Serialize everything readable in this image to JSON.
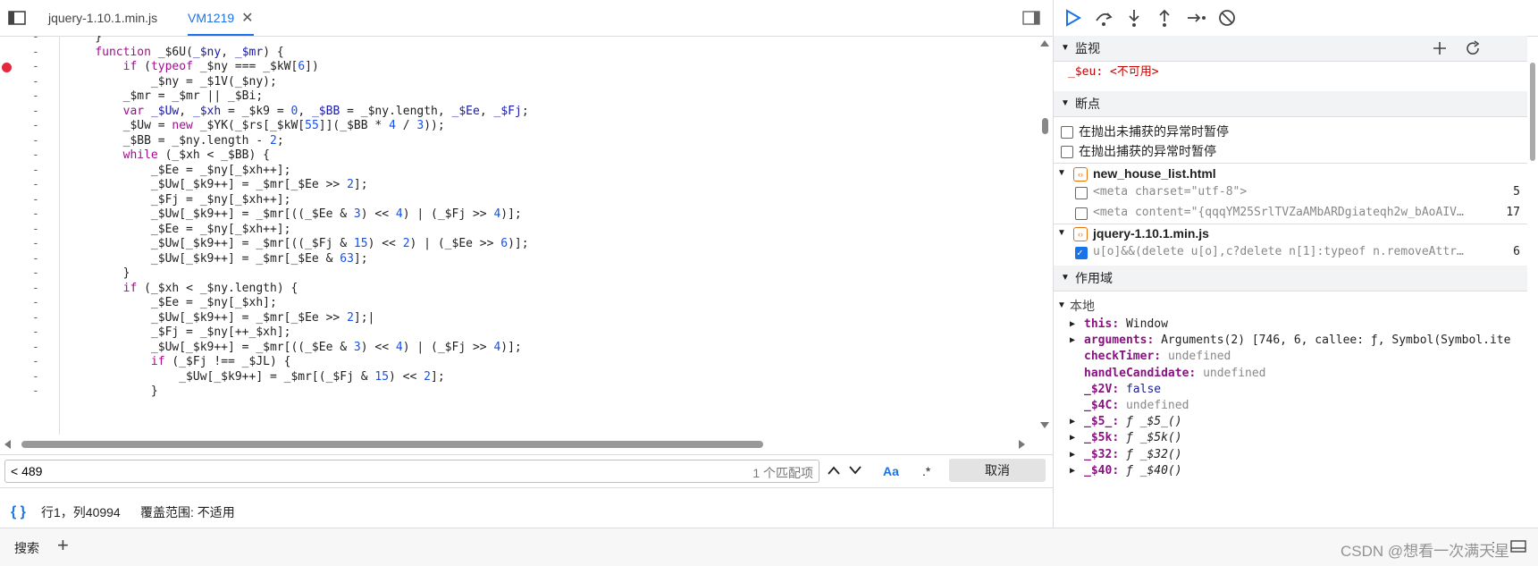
{
  "tabs": [
    {
      "label": "jquery-1.10.1.min.js"
    },
    {
      "label": "VM1219",
      "close": "✕"
    }
  ],
  "code_lines": [
    {
      "html": "    }"
    },
    {
      "html": "    <span class=\"kw\">function</span> _$6U(<span class=\"vr\">_$ny</span>, <span class=\"vr\">_$mr</span>) {"
    },
    {
      "html": "        <span class=\"kw\">if</span> (<span class=\"kw\">typeof</span> _$ny === _$kW[<span class=\"num\">6</span>])",
      "bp": true
    },
    {
      "html": "            _$ny = _$1V(_$ny);"
    },
    {
      "html": "        _$mr = _$mr || _$Bi;"
    },
    {
      "html": "        <span class=\"kw\">var</span> <span class=\"vr\">_$Uw</span>, <span class=\"vr\">_$xh</span> = _$k9 = <span class=\"num\">0</span>, <span class=\"vr\">_$BB</span> = _$ny.length, <span class=\"vr\">_$Ee</span>, <span class=\"vr\">_$Fj</span>;"
    },
    {
      "html": "        _$Uw = <span class=\"kw\">new</span> _$YK(_$rs[_$kW[<span class=\"num\">55</span>]](_$BB * <span class=\"num\">4</span> / <span class=\"num\">3</span>));"
    },
    {
      "html": "        _$BB = _$ny.length - <span class=\"num\">2</span>;"
    },
    {
      "html": "        <span class=\"kw\">while</span> (_$xh < _$BB) {"
    },
    {
      "html": "            _$Ee = _$ny[_$xh++];"
    },
    {
      "html": "            _$Uw[_$k9++] = _$mr[_$Ee >> <span class=\"num\">2</span>];"
    },
    {
      "html": "            _$Fj = _$ny[_$xh++];"
    },
    {
      "html": "            _$Uw[_$k9++] = _$mr[((_$Ee & <span class=\"num\">3</span>) << <span class=\"num\">4</span>) | (_$Fj >> <span class=\"num\">4</span>)];"
    },
    {
      "html": "            _$Ee = _$ny[_$xh++];"
    },
    {
      "html": "            _$Uw[_$k9++] = _$mr[((_$Fj & <span class=\"num\">15</span>) << <span class=\"num\">2</span>) | (_$Ee >> <span class=\"num\">6</span>)];"
    },
    {
      "html": "            _$Uw[_$k9++] = _$mr[_$Ee & <span class=\"num\">63</span>];"
    },
    {
      "html": "        }"
    },
    {
      "html": "        <span class=\"kw\">if</span> (_$xh < _$ny.length) {"
    },
    {
      "html": "            _$Ee = _$ny[_$xh];"
    },
    {
      "html": "            _$Uw[_$k9++] = _$mr[_$Ee >> <span class=\"num\">2</span>];|"
    },
    {
      "html": "            _$Fj = _$ny[++_$xh];"
    },
    {
      "html": "            _$Uw[_$k9++] = _$mr[((_$Ee & <span class=\"num\">3</span>) << <span class=\"num\">4</span>) | (_$Fj >> <span class=\"num\">4</span>)];"
    },
    {
      "html": "            <span class=\"kw\">if</span> (_$Fj !== _$JL) {"
    },
    {
      "html": "                _$Uw[_$k9++] = _$mr[(_$Fj & <span class=\"num\">15</span>) << <span class=\"num\">2</span>];"
    },
    {
      "html": "            }"
    }
  ],
  "gutter_dash": "-",
  "search": {
    "value": "< 489",
    "match_count": "1 个匹配项",
    "case_label": "Aa",
    "regex_label": ".*",
    "cancel_label": "取消"
  },
  "status": {
    "braces": "{ }",
    "position": "行1，列40994",
    "coverage": "覆盖范围: 不适用"
  },
  "watch": {
    "title": "监视",
    "expr": "_$eu",
    "value": "<不可用>"
  },
  "breakpoints": {
    "title": "断点",
    "pause_uncaught": "在抛出未捕获的异常时暂停",
    "pause_caught": "在抛出捕获的异常时暂停",
    "files": [
      {
        "name": "new_house_list.html",
        "items": [
          {
            "code": "<meta charset=\"utf-8\">",
            "line": "5",
            "checked": false
          },
          {
            "code": "<meta content=\"{qqqYM25SrlTVZaAMbARDgiateqh2w_bAoAIV…",
            "line": "17",
            "checked": false
          }
        ]
      },
      {
        "name": "jquery-1.10.1.min.js",
        "items": [
          {
            "code": "u[o]&&(delete u[o],c?delete n[1]:typeof n.removeAttr…",
            "line": "6",
            "checked": true
          }
        ]
      }
    ]
  },
  "scope": {
    "title": "作用域",
    "local_label": "本地",
    "vars": [
      {
        "name": "this",
        "value": "Window",
        "expandable": true,
        "kind": "plain"
      },
      {
        "name": "arguments",
        "value": "Arguments(2) [746, 6, callee: ƒ, Symbol(Symbol.ite",
        "expandable": true,
        "kind": "plain"
      },
      {
        "name": "checkTimer",
        "value": "undefined",
        "expandable": false,
        "kind": "undef"
      },
      {
        "name": "handleCandidate",
        "value": "undefined",
        "expandable": false,
        "kind": "undef"
      },
      {
        "name": "_$2V",
        "value": "false",
        "expandable": false,
        "kind": "bool"
      },
      {
        "name": "_$4C",
        "value": "undefined",
        "expandable": false,
        "kind": "undef"
      },
      {
        "name": "_$5_",
        "value": "ƒ _$5_()",
        "expandable": true,
        "kind": "fn"
      },
      {
        "name": "_$5k",
        "value": "ƒ _$5k()",
        "expandable": true,
        "kind": "fn"
      },
      {
        "name": "_$32",
        "value": "ƒ _$32()",
        "expandable": true,
        "kind": "fn"
      },
      {
        "name": "_$40",
        "value": "ƒ _$40()",
        "expandable": true,
        "kind": "fn"
      }
    ]
  },
  "drawer": {
    "search_tab": "搜索",
    "plus": "+"
  },
  "watermark": "CSDN @想看一次满天星"
}
